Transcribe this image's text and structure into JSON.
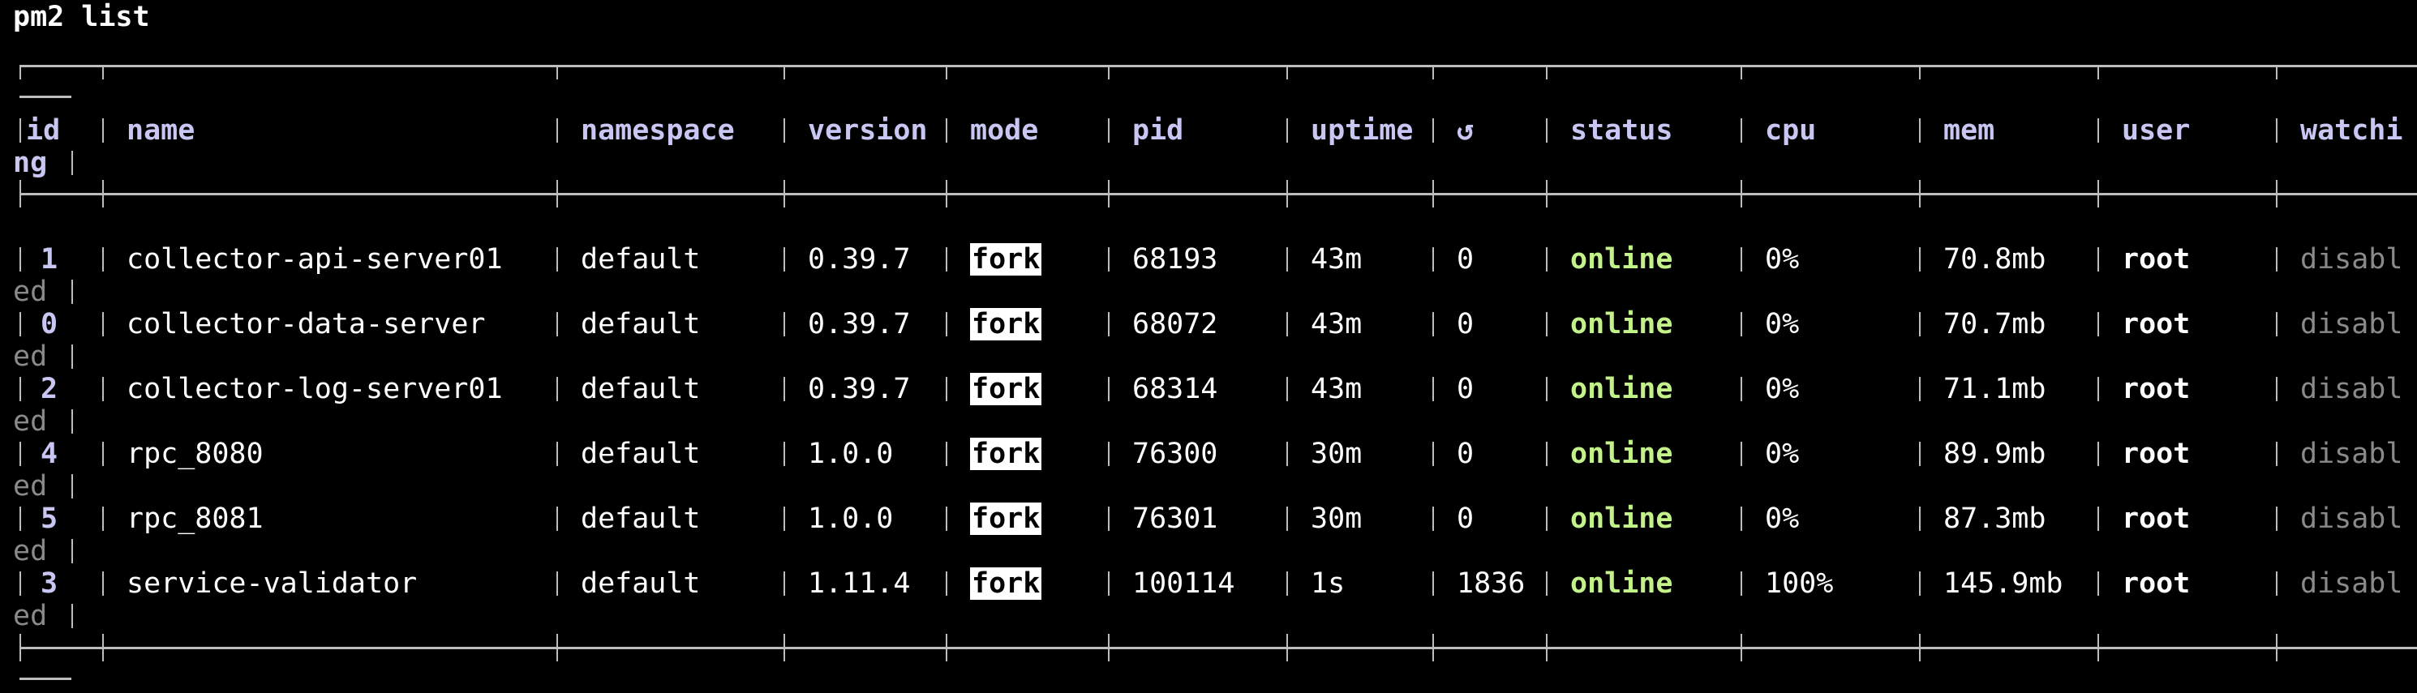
{
  "command": "pm2 list",
  "columns": [
    {
      "key": "id",
      "label": "id",
      "wrap": "ng"
    },
    {
      "key": "name",
      "label": "name"
    },
    {
      "key": "namespace",
      "label": "namespace"
    },
    {
      "key": "version",
      "label": "version"
    },
    {
      "key": "mode",
      "label": "mode"
    },
    {
      "key": "pid",
      "label": "pid"
    },
    {
      "key": "uptime",
      "label": "uptime"
    },
    {
      "key": "restarts",
      "label": "↺"
    },
    {
      "key": "status",
      "label": "status"
    },
    {
      "key": "cpu",
      "label": "cpu"
    },
    {
      "key": "mem",
      "label": "mem"
    },
    {
      "key": "user",
      "label": "user"
    },
    {
      "key": "watching",
      "label": "watchi"
    }
  ],
  "rows": [
    {
      "id": "1",
      "name": "collector-api-server01",
      "namespace": "default",
      "version": "0.39.7",
      "mode": "fork",
      "pid": "68193",
      "uptime": "43m",
      "restarts": "0",
      "status": "online",
      "cpu": "0%",
      "mem": "70.8mb",
      "user": "root",
      "watching": "disabl",
      "watching_wrap": "ed"
    },
    {
      "id": "0",
      "name": "collector-data-server",
      "namespace": "default",
      "version": "0.39.7",
      "mode": "fork",
      "pid": "68072",
      "uptime": "43m",
      "restarts": "0",
      "status": "online",
      "cpu": "0%",
      "mem": "70.7mb",
      "user": "root",
      "watching": "disabl",
      "watching_wrap": "ed"
    },
    {
      "id": "2",
      "name": "collector-log-server01",
      "namespace": "default",
      "version": "0.39.7",
      "mode": "fork",
      "pid": "68314",
      "uptime": "43m",
      "restarts": "0",
      "status": "online",
      "cpu": "0%",
      "mem": "71.1mb",
      "user": "root",
      "watching": "disabl",
      "watching_wrap": "ed"
    },
    {
      "id": "4",
      "name": "rpc_8080",
      "namespace": "default",
      "version": "1.0.0",
      "mode": "fork",
      "pid": "76300",
      "uptime": "30m",
      "restarts": "0",
      "status": "online",
      "cpu": "0%",
      "mem": "89.9mb",
      "user": "root",
      "watching": "disabl",
      "watching_wrap": "ed"
    },
    {
      "id": "5",
      "name": "rpc_8081",
      "namespace": "default",
      "version": "1.0.0",
      "mode": "fork",
      "pid": "76301",
      "uptime": "30m",
      "restarts": "0",
      "status": "online",
      "cpu": "0%",
      "mem": "87.3mb",
      "user": "root",
      "watching": "disabl",
      "watching_wrap": "ed"
    },
    {
      "id": "3",
      "name": "service-validator",
      "namespace": "default",
      "version": "1.11.4",
      "mode": "fork",
      "pid": "100114",
      "uptime": "1s",
      "restarts": "1836",
      "status": "online",
      "cpu": "100%",
      "mem": "145.9mb",
      "user": "root",
      "watching": "disabl",
      "watching_wrap": "ed"
    }
  ],
  "colors": {
    "background": "#000000",
    "header": "#c8c6f2",
    "online": "#c3f28a",
    "disabled": "#8a8a8a",
    "border": "#bdbdbd"
  }
}
